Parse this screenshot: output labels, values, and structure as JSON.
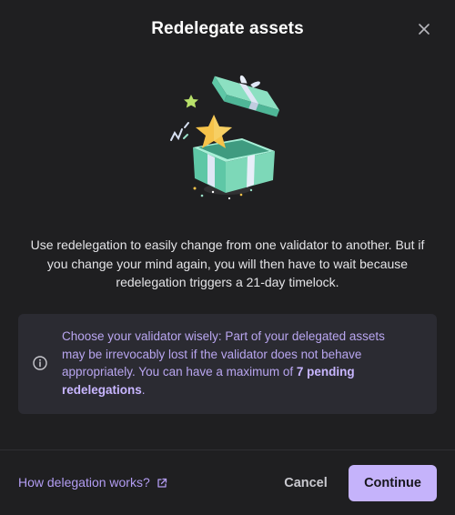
{
  "modal": {
    "title": "Redelegate assets",
    "close_icon": "close-icon"
  },
  "illustration": {
    "icon": "gift-box-with-star-icon",
    "colors": {
      "box": "#6fd1b2",
      "ribbon": "#d8e1f2",
      "star": "#f6c34a"
    }
  },
  "description": "Use redelegation to easily change from one validator to another. But if you change your mind again, you will then have to wait because redelegation triggers a 21-day timelock.",
  "warning": {
    "icon": "info-icon",
    "text_before": "Choose your validator wisely: Part of your delegated assets may be irrevocably lost if the validator does not behave appropriately. You can have a maximum of ",
    "text_bold": "7 pending redelegations",
    "text_after": "."
  },
  "footer": {
    "help_link": "How delegation works?",
    "help_link_icon": "external-link-icon",
    "cancel_label": "Cancel",
    "continue_label": "Continue"
  },
  "colors": {
    "background": "#1f1f21",
    "accent": "#c5b3fb",
    "warning_bg": "#2b2b32",
    "warning_text": "#b9a6f0"
  }
}
